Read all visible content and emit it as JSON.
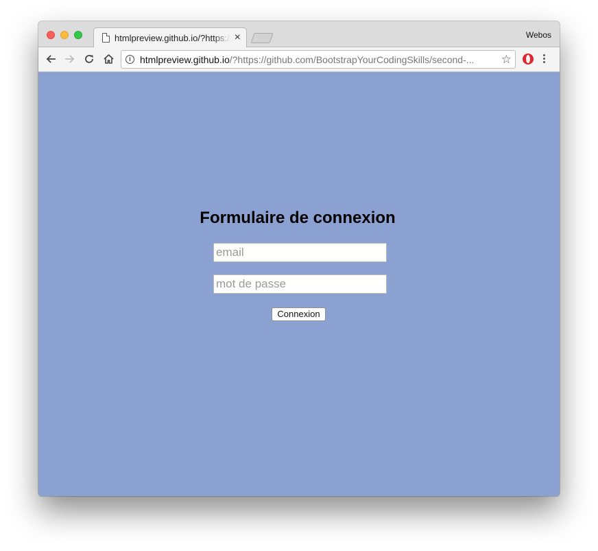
{
  "browser": {
    "tab": {
      "title": "htmlpreview.github.io/?https://github.com/BootstrapYourCodingSkills/second-",
      "close_glyph": "×"
    },
    "profile_name": "Webos",
    "address_bar": {
      "host": "htmlpreview.github.io",
      "path": "/?https://github.com/BootstrapYourCodingSkills/second-..."
    },
    "icons": {
      "back": "back-arrow-icon",
      "forward": "forward-arrow-icon",
      "reload": "reload-icon",
      "home": "home-icon",
      "info": "info-icon",
      "bookmark": "star-icon",
      "extension": "opera-icon",
      "menu": "menu-dots-icon"
    },
    "star_glyph": "☆",
    "info_glyph": "i"
  },
  "page": {
    "background_color": "#8aa1d2",
    "title": "Formulaire de connexion",
    "email_placeholder": "email",
    "password_placeholder": "mot de passe",
    "submit_label": "Connexion"
  }
}
